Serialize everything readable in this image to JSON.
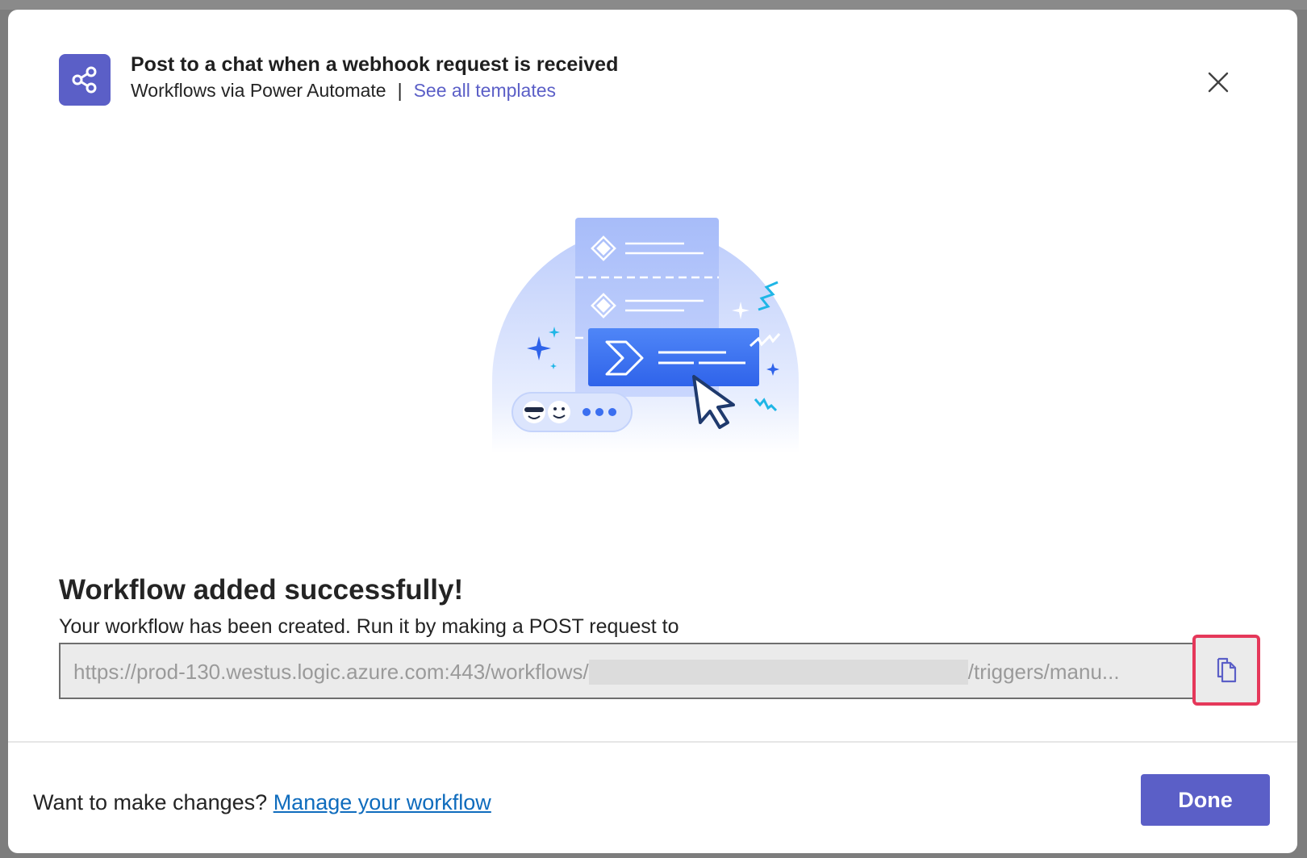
{
  "header": {
    "title": "Post to a chat when a webhook request is received",
    "source": "Workflows via Power Automate",
    "separator": "|",
    "templates_link": "See all templates",
    "app_icon": "share-nodes-icon",
    "close_icon": "close-icon"
  },
  "main": {
    "title": "Workflow added successfully!",
    "description": "Your workflow has been created. Run it by making a POST request to",
    "url_prefix": "https://prod-130.westus.logic.azure.com:443/workflows/",
    "url_suffix": "/triggers/manu...",
    "copy_icon": "copy-icon"
  },
  "footer": {
    "prompt": "Want to make changes?",
    "manage_link": "Manage your workflow",
    "done_label": "Done"
  },
  "colors": {
    "brand": "#5b5fc7",
    "link": "#0f6cbd",
    "highlight": "#e5385a"
  }
}
